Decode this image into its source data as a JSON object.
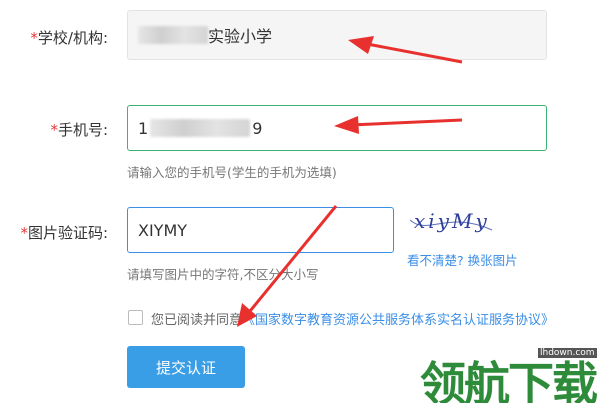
{
  "form": {
    "school": {
      "required_mark": "*",
      "label": "学校/机构:",
      "value_suffix": "实验小学"
    },
    "phone": {
      "required_mark": "*",
      "label": "手机号:",
      "value_prefix": "1",
      "value_suffix": "9",
      "hint": "请输入您的手机号(学生的手机为选填)"
    },
    "captcha": {
      "required_mark": "*",
      "label": "图片验证码:",
      "value": "XIYMY",
      "hint": "请填写图片中的字符,不区分大小写",
      "image_text": "xiyMy",
      "refresh_link": "看不清楚? 换张图片"
    },
    "agreement": {
      "checked": false,
      "text": "您已阅读并同意",
      "link": "《国家数字教育资源公共服务体系实名认证服务协议》"
    },
    "submit_label": "提交认证"
  },
  "watermark": {
    "text": "领航下载",
    "url": "lhdown.com"
  },
  "colors": {
    "required": "#e4393c",
    "link": "#3a8ee6",
    "submit": "#3a9ee6",
    "arrow": "#e8312f",
    "watermark": "#2e8b3a"
  }
}
